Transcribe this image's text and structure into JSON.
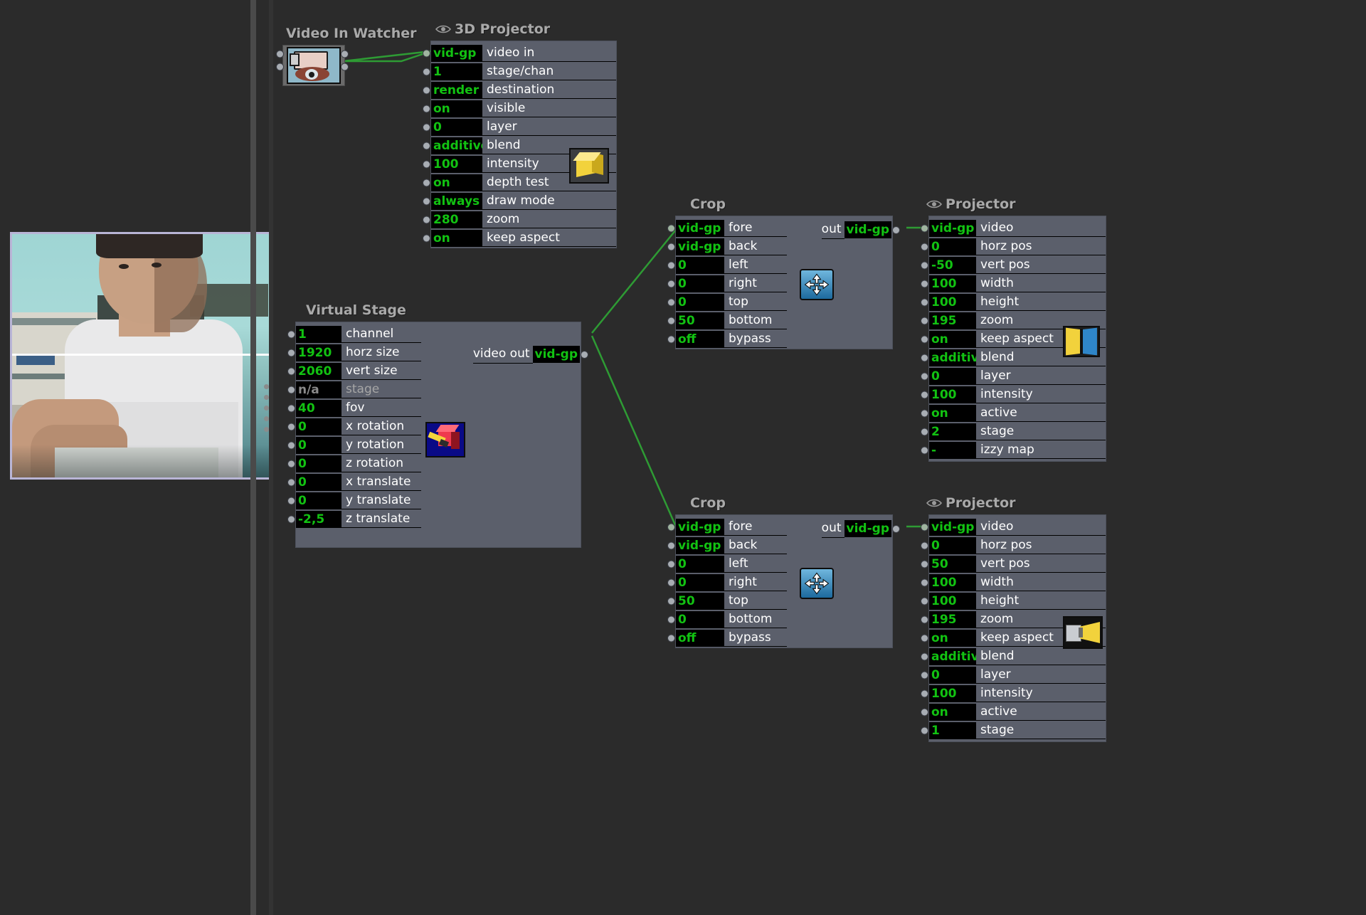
{
  "app": {
    "name": "Isadora Scene Editor",
    "canvas_bg": "#2b2b2b",
    "node_bg": "#5b5f6b",
    "value_text_color": "#12c212",
    "link_color": "#2e9b34",
    "title_color": "#a9a9a9"
  },
  "preview": {
    "name": "stage-preview",
    "border_color": "#b9b5d6"
  },
  "nodes": [
    {
      "id": "video-in-watcher",
      "title": "Video In Watcher",
      "has_eye": false,
      "icon": "video-watcher-icon",
      "inputs": [],
      "outputs": []
    },
    {
      "id": "3d-projector",
      "title": "3D Projector",
      "has_eye": true,
      "icon": "yellow-cube-icon",
      "params": [
        {
          "value": "vid-gp",
          "label": "video in",
          "linked": true
        },
        {
          "value": "1",
          "label": "stage/chan",
          "linked": false
        },
        {
          "value": "render",
          "label": "destination",
          "linked": false
        },
        {
          "value": "on",
          "label": "visible",
          "linked": false
        },
        {
          "value": "0",
          "label": "layer",
          "linked": false
        },
        {
          "value": "additive",
          "label": "blend",
          "linked": false
        },
        {
          "value": "100",
          "label": "intensity",
          "linked": false
        },
        {
          "value": "on",
          "label": "depth test",
          "linked": false
        },
        {
          "value": "always",
          "label": "draw mode",
          "linked": false
        },
        {
          "value": "280",
          "label": "zoom",
          "linked": false
        },
        {
          "value": "on",
          "label": "keep aspect",
          "linked": false
        }
      ],
      "outputs": []
    },
    {
      "id": "virtual-stage",
      "title": "Virtual Stage",
      "has_eye": false,
      "icon": "red-cube-icon",
      "params": [
        {
          "value": "1",
          "label": "channel",
          "linked": false
        },
        {
          "value": "1920",
          "label": "horz size",
          "linked": false
        },
        {
          "value": "2060",
          "label": "vert size",
          "linked": false
        },
        {
          "value": "n/a",
          "label": "stage",
          "linked": false,
          "disabled": true
        },
        {
          "value": "40",
          "label": "fov",
          "linked": false
        },
        {
          "value": "0",
          "label": "x rotation",
          "linked": false
        },
        {
          "value": "0",
          "label": "y rotation",
          "linked": false
        },
        {
          "value": "0",
          "label": "z rotation",
          "linked": false
        },
        {
          "value": "0",
          "label": "x translate",
          "linked": false
        },
        {
          "value": "0",
          "label": "y translate",
          "linked": false
        },
        {
          "value": "-2,5",
          "label": "z translate",
          "linked": false
        }
      ],
      "outputs": [
        {
          "label": "video out",
          "value": "vid-gp"
        }
      ]
    },
    {
      "id": "crop-top",
      "title": "Crop",
      "has_eye": false,
      "icon": "crop-icon",
      "params": [
        {
          "value": "vid-gp",
          "label": "fore",
          "linked": true
        },
        {
          "value": "vid-gp",
          "label": "back",
          "linked": false
        },
        {
          "value": "0",
          "label": "left",
          "linked": false
        },
        {
          "value": "0",
          "label": "right",
          "linked": false
        },
        {
          "value": "0",
          "label": "top",
          "linked": false
        },
        {
          "value": "50",
          "label": "bottom",
          "linked": false
        },
        {
          "value": "off",
          "label": "bypass",
          "linked": false
        }
      ],
      "outputs": [
        {
          "label": "out",
          "value": "vid-gp"
        }
      ]
    },
    {
      "id": "crop-bottom",
      "title": "Crop",
      "has_eye": false,
      "icon": "crop-icon",
      "params": [
        {
          "value": "vid-gp",
          "label": "fore",
          "linked": true
        },
        {
          "value": "vid-gp",
          "label": "back",
          "linked": false
        },
        {
          "value": "0",
          "label": "left",
          "linked": false
        },
        {
          "value": "0",
          "label": "right",
          "linked": false
        },
        {
          "value": "50",
          "label": "top",
          "linked": false
        },
        {
          "value": "0",
          "label": "bottom",
          "linked": false
        },
        {
          "value": "off",
          "label": "bypass",
          "linked": false
        }
      ],
      "outputs": [
        {
          "label": "out",
          "value": "vid-gp"
        }
      ]
    },
    {
      "id": "projector-top",
      "title": "Projector",
      "has_eye": true,
      "icon": "projector-map-icon",
      "params": [
        {
          "value": "vid-gp",
          "label": "video",
          "linked": true
        },
        {
          "value": "0",
          "label": "horz pos",
          "linked": false
        },
        {
          "value": "-50",
          "label": "vert pos",
          "linked": false
        },
        {
          "value": "100",
          "label": "width",
          "linked": false
        },
        {
          "value": "100",
          "label": "height",
          "linked": false
        },
        {
          "value": "195",
          "label": "zoom",
          "linked": false
        },
        {
          "value": "on",
          "label": "keep aspect",
          "linked": false
        },
        {
          "value": "additive",
          "label": "blend",
          "linked": false
        },
        {
          "value": "0",
          "label": "layer",
          "linked": false
        },
        {
          "value": "100",
          "label": "intensity",
          "linked": false
        },
        {
          "value": "on",
          "label": "active",
          "linked": false
        },
        {
          "value": "2",
          "label": "stage",
          "linked": false
        },
        {
          "value": "-",
          "label": "izzy map",
          "linked": false
        }
      ],
      "outputs": []
    },
    {
      "id": "projector-bottom",
      "title": "Projector",
      "has_eye": true,
      "icon": "projector-beam-icon",
      "params": [
        {
          "value": "vid-gp",
          "label": "video",
          "linked": true
        },
        {
          "value": "0",
          "label": "horz pos",
          "linked": false
        },
        {
          "value": "50",
          "label": "vert pos",
          "linked": false
        },
        {
          "value": "100",
          "label": "width",
          "linked": false
        },
        {
          "value": "100",
          "label": "height",
          "linked": false
        },
        {
          "value": "195",
          "label": "zoom",
          "linked": false
        },
        {
          "value": "on",
          "label": "keep aspect",
          "linked": false
        },
        {
          "value": "additive",
          "label": "blend",
          "linked": false
        },
        {
          "value": "0",
          "label": "layer",
          "linked": false
        },
        {
          "value": "100",
          "label": "intensity",
          "linked": false
        },
        {
          "value": "on",
          "label": "active",
          "linked": false
        },
        {
          "value": "1",
          "label": "stage",
          "linked": false
        }
      ],
      "outputs": []
    }
  ]
}
